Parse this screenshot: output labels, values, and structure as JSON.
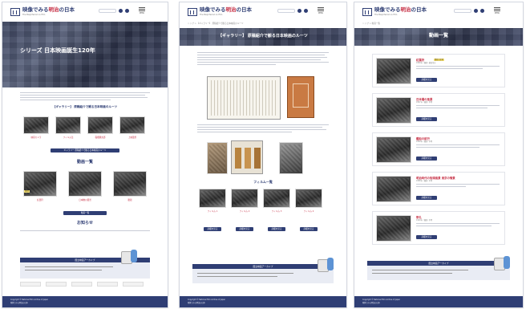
{
  "header": {
    "site_title_a": "映像でみる",
    "site_title_b": "明治",
    "site_title_c": "の日本",
    "site_subtitle": "The Meiji Period on Film",
    "menu_label": "MENU"
  },
  "page1": {
    "hero_title": "シリーズ 日本映画誕生120年",
    "gallery_title": "【ギャラリー】",
    "gallery_heading": "【ギャラリー】 原稿紹介で観る日本映画のルーツ",
    "gallery_button": "ギャラリー 原稿紹介で観る日本映画のルーツ",
    "video_list_title": "動画一覧",
    "video_list_button": "動画一覧",
    "news_title": "お知らせ",
    "gallery_captions": [
      "映画カメラ",
      "フィルム缶",
      "稲畑勝太郎",
      "上映風景"
    ],
    "video_captions": [
      "紅葉狩",
      "日本橋の風景",
      "艦船"
    ]
  },
  "page2": {
    "breadcrumb": "トップ > 【ギャラリー】 原稿紹介で観る日本映画のルーツ",
    "banner_title": "【ギャラリー】 原稿紹介で観る日本映画のルーツ",
    "film_list_title": "フィルム一覧",
    "film_captions": [
      "フィルム 1",
      "フィルム 2",
      "フィルム 3",
      "フィルム 4"
    ],
    "button_label": "詳細を見る"
  },
  "page3": {
    "breadcrumb": "トップ > 動画一覧",
    "banner_title": "動画一覧",
    "videos": [
      {
        "title": "紅葉狩",
        "sub": "1899年 / 撮影: 柴田常吉",
        "badge": "重要文化財"
      },
      {
        "title": "日本橋の風景",
        "sub": "1897年 / 撮影: 不明",
        "badge": ""
      },
      {
        "title": "艦船の航行",
        "sub": "1899年 / 撮影: 不明",
        "badge": ""
      },
      {
        "title": "明治時代の街頭風景 東京の情景",
        "sub": "1898年 / 撮影: 不明",
        "badge": ""
      },
      {
        "title": "祭礼",
        "sub": "1900年 / 撮影: 不明",
        "badge": ""
      }
    ],
    "button_label": "詳細を見る"
  },
  "footer": {
    "pr_title": "国立映画アーカイブ",
    "copyright": "Copyright © National Film Archive of Japan",
    "credit": "映像でみる明治の日本"
  },
  "colors": {
    "navy": "#2f3e74",
    "accent_red": "#c73348",
    "pr_box": "#e9ecf4"
  }
}
